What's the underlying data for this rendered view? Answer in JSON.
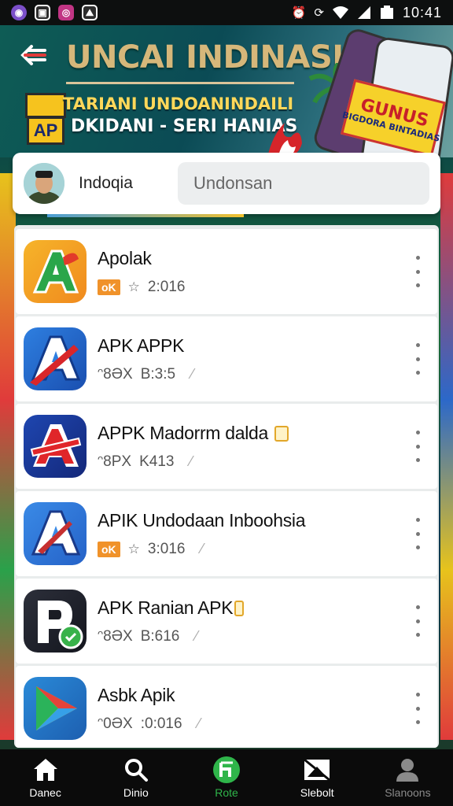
{
  "status_bar": {
    "time": "10:41",
    "apps": [
      {
        "icon": "viber-icon",
        "color": "#7b4fc9",
        "glyph": "◉"
      },
      {
        "icon": "messenger-icon",
        "color": "#2c2c2c",
        "glyph": "▣"
      },
      {
        "icon": "instagram-icon",
        "color": "#c13584",
        "glyph": "◎"
      },
      {
        "icon": "gallery-icon",
        "color": "#2c2c2c",
        "glyph": "⛰"
      }
    ]
  },
  "banner": {
    "title": "UNCAI INDINASIA",
    "line1": "TARIANI UNDOANINDAILI",
    "line2": "DKIDANI - SERI HANIAS",
    "badge": "AP",
    "bonus_big": "GUNUS",
    "bonus_small": "BIGDORA BINTADIAS"
  },
  "profile": {
    "name": "Indoqia",
    "search_placeholder": "Undonsan"
  },
  "apps": [
    {
      "name": "Apolak",
      "tag": "oK",
      "has_tag": true,
      "meta_glyph": "☆",
      "meta_value": "2:016",
      "badge": false,
      "icon": "a-green-icon"
    },
    {
      "name": "APK APPK",
      "tag": "",
      "has_tag": false,
      "prefix": "ᵔ8ƏX",
      "meta_glyph": "",
      "meta_value": "B:3:5",
      "badge": false,
      "icon": "a-blue-icon"
    },
    {
      "name": "APPK Madorrm dalda",
      "tag": "",
      "has_tag": false,
      "prefix": "ᵔ8PX",
      "meta_glyph": "",
      "meta_value": "K413",
      "badge": true,
      "icon": "a-red-icon"
    },
    {
      "name": "APIK Undodaan Inboohsia",
      "tag": "oK",
      "has_tag": true,
      "meta_glyph": "☆",
      "meta_value": "3:016",
      "badge": false,
      "icon": "a-light-blue-icon"
    },
    {
      "name": "APK Ranian APK",
      "tag": "",
      "has_tag": false,
      "prefix": "ᵔ8ƏX",
      "meta_glyph": "",
      "meta_value": "B:616",
      "badge": true,
      "icon": "p-icon"
    },
    {
      "name": "Asbk Apik",
      "tag": "",
      "has_tag": false,
      "prefix": "ᵔ0ƏX",
      "meta_glyph": "",
      "meta_value": ":0:016",
      "badge": false,
      "icon": "play-arrow-icon"
    }
  ],
  "nav": [
    {
      "label": "Danec",
      "icon": "home-icon"
    },
    {
      "label": "Dinio",
      "icon": "search-icon"
    },
    {
      "label": "Rote",
      "icon": "r-circle-icon"
    },
    {
      "label": "Slebolt",
      "icon": "message-icon"
    },
    {
      "label": "Slanoons",
      "icon": "person-icon"
    }
  ],
  "colors": {
    "accent_green": "#2fb54a",
    "tag_orange": "#f0922a",
    "banner_title": "#d6b77a"
  }
}
